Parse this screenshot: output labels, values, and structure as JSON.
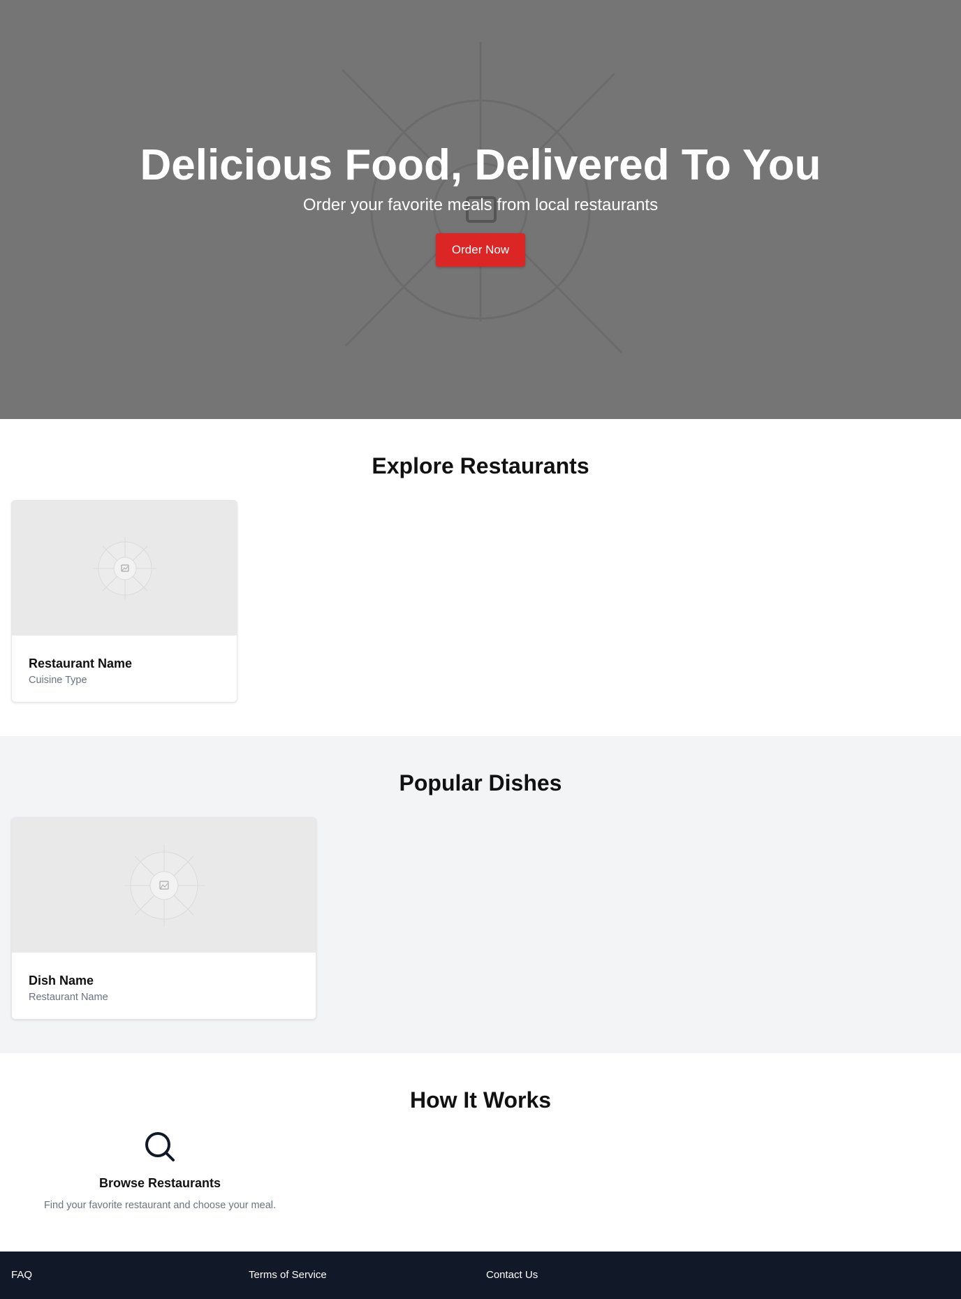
{
  "hero": {
    "title": "Delicious Food, Delivered To You",
    "subtitle": "Order your favorite meals from local restaurants",
    "cta_label": "Order Now",
    "background_color": "#757575",
    "cta_color": "#dc2626"
  },
  "restaurants": {
    "title": "Explore Restaurants",
    "cards": [
      {
        "name": "Restaurant Name",
        "cuisine": "Cuisine Type",
        "image_icon": "image-placeholder-icon"
      }
    ]
  },
  "dishes": {
    "title": "Popular Dishes",
    "background_color": "#f3f4f6",
    "cards": [
      {
        "name": "Dish Name",
        "restaurant": "Restaurant Name",
        "image_icon": "image-placeholder-icon"
      }
    ]
  },
  "how_it_works": {
    "title": "How It Works",
    "steps": [
      {
        "icon": "search-icon",
        "title": "Browse Restaurants",
        "description": "Find your favorite restaurant and choose your meal."
      }
    ]
  },
  "footer": {
    "background_color": "#111827",
    "links": [
      "FAQ",
      "Terms of Service",
      "Contact Us"
    ]
  }
}
